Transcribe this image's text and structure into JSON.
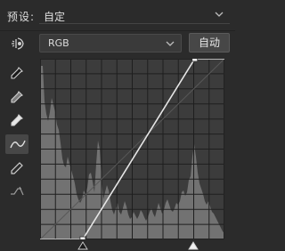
{
  "preset": {
    "label": "预设:",
    "value": "自定"
  },
  "channel": {
    "value": "RGB"
  },
  "auto_button": {
    "label": "自动"
  },
  "tools": [
    {
      "icon": "on-image-adjust-icon"
    },
    {
      "icon": "black-point-eyedropper-icon"
    },
    {
      "icon": "gray-point-eyedropper-icon"
    },
    {
      "icon": "white-point-eyedropper-icon"
    },
    {
      "icon": "curve-edit-points-icon",
      "active": true
    },
    {
      "icon": "pencil-draw-icon"
    },
    {
      "icon": "smooth-curve-icon"
    }
  ],
  "curve": {
    "input_range": [
      0,
      255
    ],
    "output_range": [
      0,
      255
    ],
    "points": [
      {
        "input": 0,
        "output": 0
      },
      {
        "input": 59,
        "output": 0
      },
      {
        "input": 214,
        "output": 255
      },
      {
        "input": 255,
        "output": 255
      }
    ],
    "grid_divisions": 4,
    "histogram_shown": true
  },
  "colors": {
    "panel_bg": "#2b2b2b",
    "graph_bg": "#3c3c3c",
    "histogram": "#727272",
    "curve": "#e6e6e6"
  }
}
